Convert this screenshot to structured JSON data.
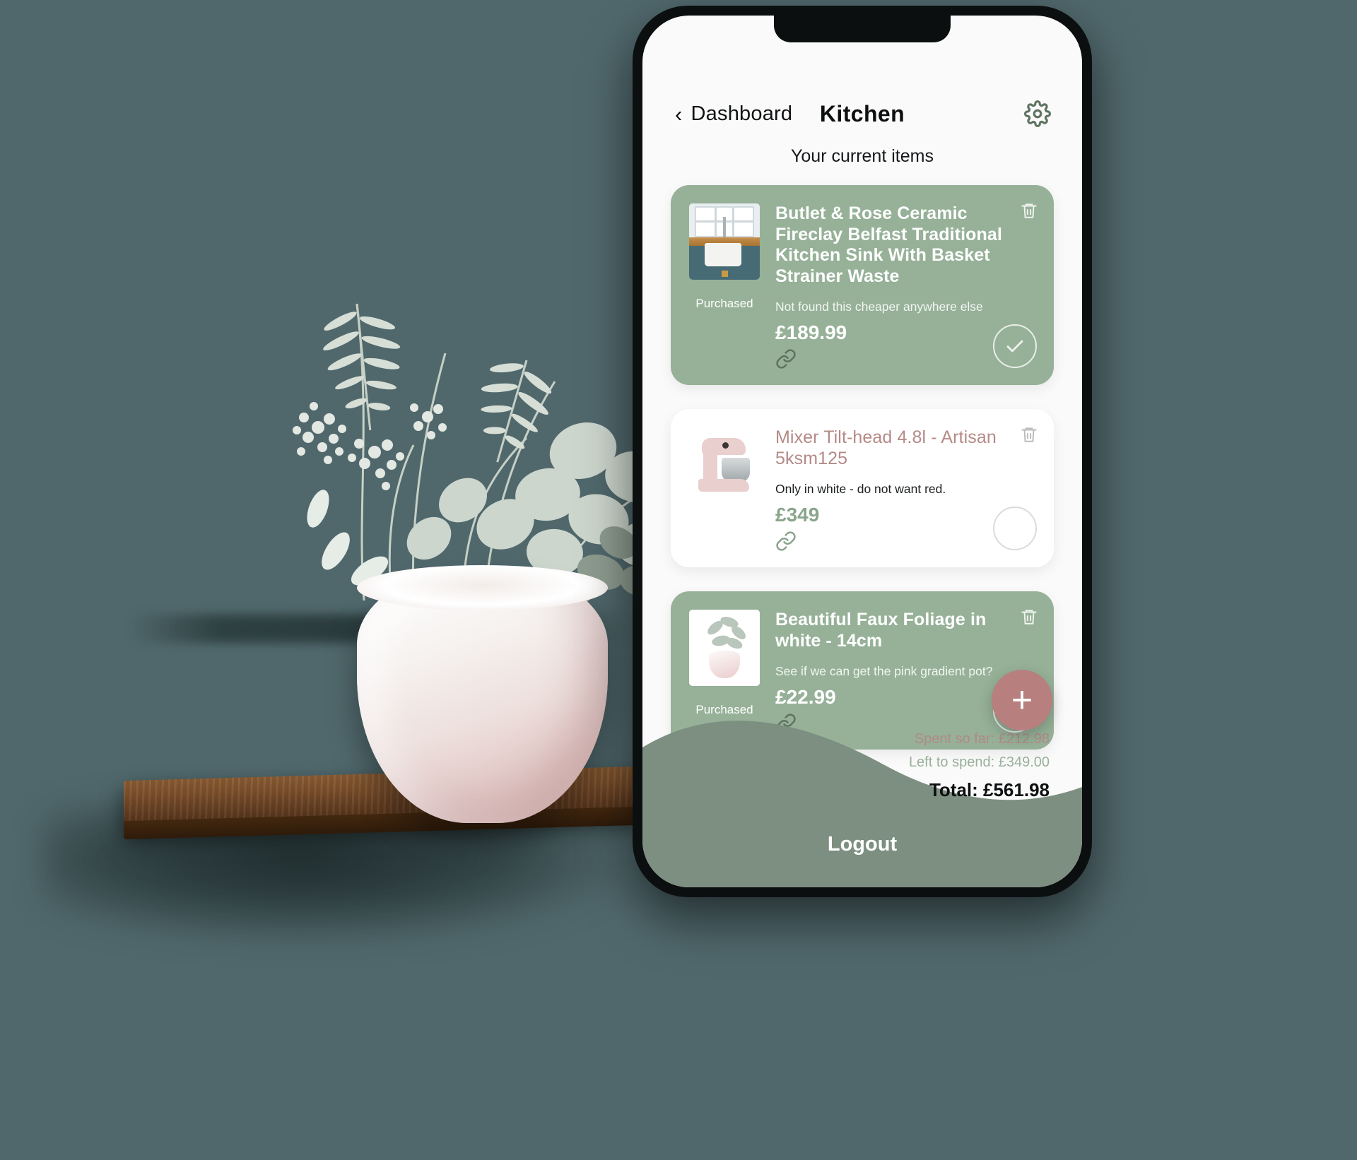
{
  "app": {
    "nav": {
      "back_label": "Dashboard",
      "back_chevron": "‹",
      "title": "Kitchen",
      "settings_icon": "gear-icon"
    },
    "subtitle": "Your current items",
    "accent_green": "#96b198",
    "accent_rose": "#b48a87",
    "footer_green": "#7d8f81"
  },
  "items": [
    {
      "title": "Butlet & Rose Ceramic Fireclay Belfast Traditional Kitchen Sink With Basket Strainer Waste",
      "note": "Not found this cheaper anywhere else",
      "price": "£189.99",
      "status": "Purchased",
      "purchased": true,
      "thumb": "kitchen-sink-thumbnail",
      "link_icon": "link-icon",
      "delete_icon": "trash-icon",
      "check_icon": "check-icon"
    },
    {
      "title": "Mixer Tilt-head 4.8l - Artisan 5ksm125",
      "note": "Only in white - do not want red.",
      "price": "£349",
      "status": "",
      "purchased": false,
      "thumb": "stand-mixer-thumbnail",
      "link_icon": "link-icon",
      "delete_icon": "trash-icon",
      "check_icon": "empty-circle-icon"
    },
    {
      "title": "Beautiful Faux Foliage in white - 14cm",
      "note": "See if we can get the pink gradient pot?",
      "price": "£22.99",
      "status": "Purchased",
      "purchased": true,
      "thumb": "faux-foliage-thumbnail",
      "link_icon": "link-icon",
      "delete_icon": "trash-icon",
      "check_icon": "check-icon"
    }
  ],
  "fab": {
    "label": "+",
    "icon": "plus-icon"
  },
  "totals": {
    "spent": "Spent so far: £212.98",
    "left": "Left to spend: £349.00",
    "total": "Total: £561.98"
  },
  "footer": {
    "logout_label": "Logout"
  }
}
